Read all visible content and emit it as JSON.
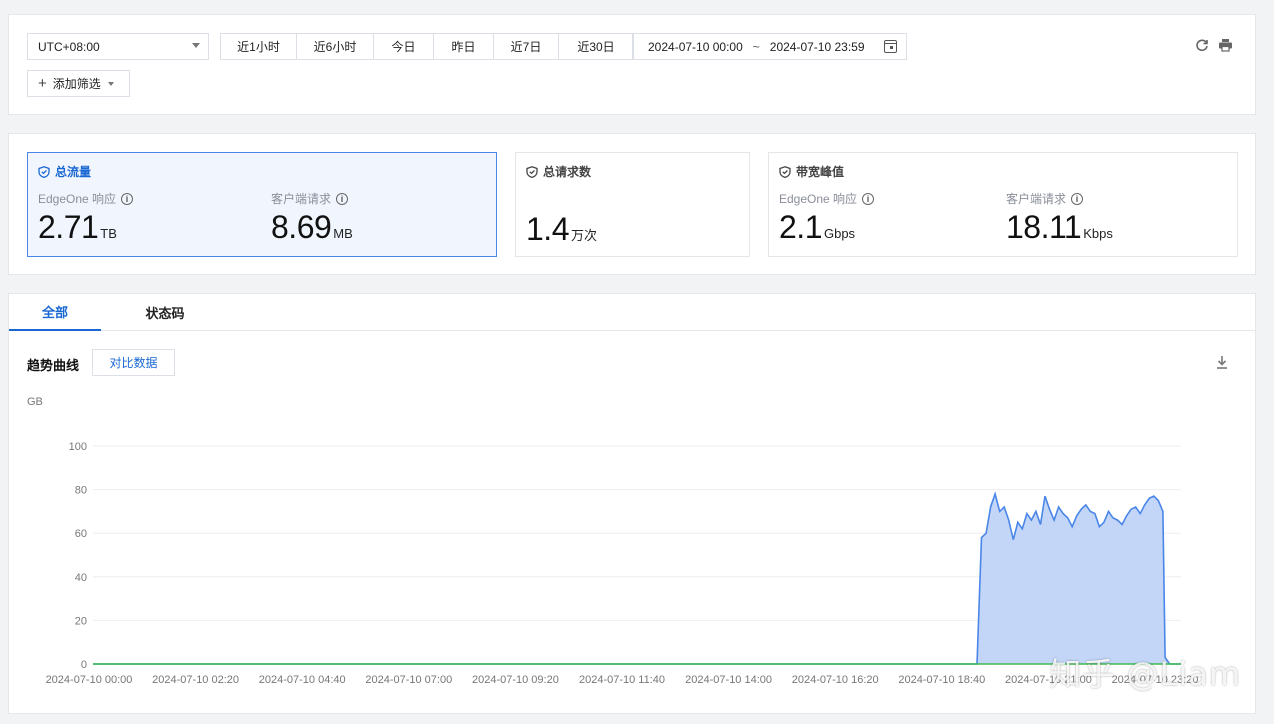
{
  "filter": {
    "timezone": "UTC+08:00",
    "ranges": [
      "近1小时",
      "近6小时",
      "今日",
      "昨日",
      "近7日",
      "近30日"
    ],
    "date_start": "2024-07-10 00:00",
    "date_sep": "~",
    "date_end": "2024-07-10 23:59",
    "add_filter_label": "添加筛选",
    "refresh_icon": "refresh-icon",
    "print_icon": "print-icon"
  },
  "metrics": {
    "total_traffic": {
      "title": "总流量",
      "items": [
        {
          "label": "EdgeOne 响应",
          "value": "2.71",
          "unit": "TB"
        },
        {
          "label": "客户端请求",
          "value": "8.69",
          "unit": "MB"
        }
      ]
    },
    "total_requests": {
      "title": "总请求数",
      "value": "1.4",
      "unit": "万次"
    },
    "peak_bandwidth": {
      "title": "带宽峰值",
      "items": [
        {
          "label": "EdgeOne 响应",
          "value": "2.1",
          "unit": "Gbps"
        },
        {
          "label": "客户端请求",
          "value": "18.11",
          "unit": "Kbps"
        }
      ]
    }
  },
  "tabs": [
    "全部",
    "状态码"
  ],
  "trend": {
    "title": "趋势曲线",
    "compare_label": "对比数据"
  },
  "watermark": "知乎 @Liam",
  "colors": {
    "accent": "#1967d2",
    "series_fill": "#c3d6f7",
    "series_stroke": "#4a86e8",
    "client_line": "#3dbb4f"
  },
  "chart_data": {
    "type": "area",
    "ylabel": "GB",
    "ylim": [
      0,
      100
    ],
    "yticks": [
      0,
      20,
      40,
      60,
      80,
      100
    ],
    "xtick_labels": [
      "2024-07-10 00:00",
      "2024-07-10 02:20",
      "2024-07-10 04:40",
      "2024-07-10 07:00",
      "2024-07-10 09:20",
      "2024-07-10 11:40",
      "2024-07-10 14:00",
      "2024-07-10 16:20",
      "2024-07-10 18:40",
      "2024-07-10 21:00",
      "2024-07-10 23:20"
    ],
    "x_domain_hours": [
      0,
      24
    ],
    "series": [
      {
        "x_hours": [
          0,
          19.5,
          19.6,
          19.7,
          19.8,
          19.9,
          20.0,
          20.1,
          20.2,
          20.3,
          20.4,
          20.5,
          20.6,
          20.7,
          20.8,
          20.9,
          21.0,
          21.1,
          21.2,
          21.3,
          21.4,
          21.5,
          21.6,
          21.7,
          21.8,
          21.9,
          22.0,
          22.1,
          22.2,
          22.3,
          22.4,
          22.5,
          22.6,
          22.7,
          22.8,
          22.9,
          23.0,
          23.1,
          23.2,
          23.3,
          23.4,
          23.5,
          23.6,
          23.65,
          23.75,
          24.0
        ],
        "values": [
          0,
          0,
          58,
          60,
          72,
          78,
          70,
          72,
          66,
          57,
          65,
          62,
          69,
          66,
          70,
          64,
          77,
          71,
          66,
          72,
          69,
          67,
          63,
          68,
          71,
          73,
          70,
          69,
          63,
          65,
          70,
          67,
          66,
          64,
          68,
          71,
          72,
          69,
          73,
          76,
          77,
          75,
          70,
          3,
          0,
          0
        ]
      },
      {
        "x_hours": [
          0,
          24
        ],
        "values": [
          0,
          0
        ]
      }
    ]
  }
}
